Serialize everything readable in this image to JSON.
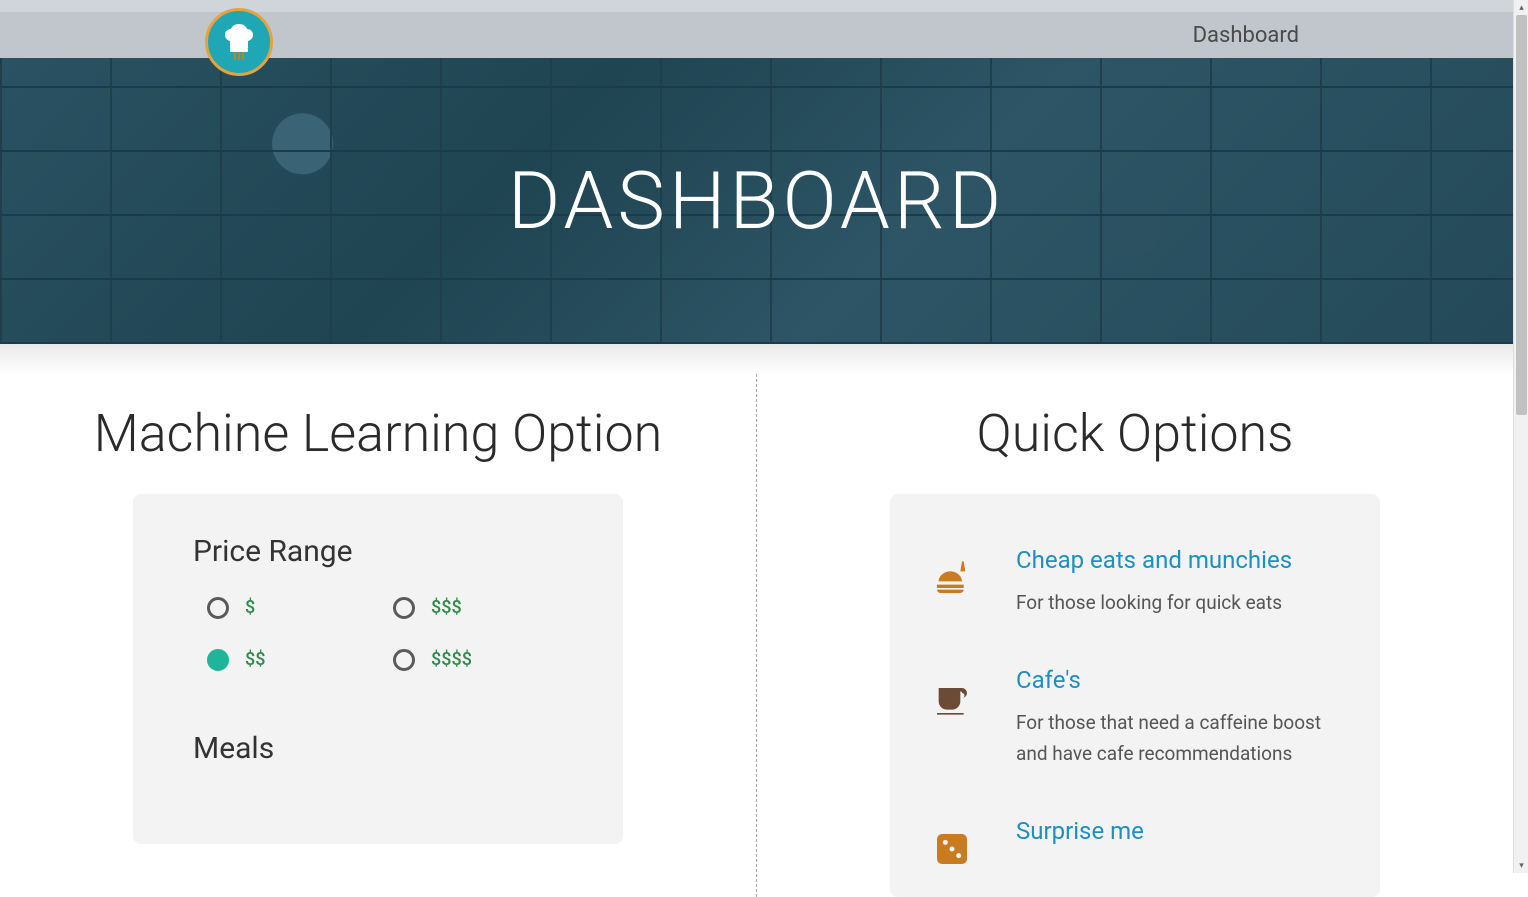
{
  "nav": {
    "link_dashboard": "Dashboard"
  },
  "hero": {
    "title": "DASHBOARD"
  },
  "ml": {
    "section_title": "Machine Learning Option",
    "price_range_heading": "Price Range",
    "next_heading": "Meals",
    "prices": [
      "$",
      "$$",
      "$$$",
      "$$$$"
    ],
    "selected_index": 1,
    "colors": {
      "radio_selected": "#1fb59b",
      "price_text": "#2f8b4a"
    }
  },
  "quick": {
    "section_title": "Quick Options",
    "items": [
      {
        "icon": "fastfood",
        "title": "Cheap eats and munchies",
        "desc": "For those looking for quick eats"
      },
      {
        "icon": "coffee",
        "title": "Cafe's",
        "desc": "For those that need a caffeine boost and have cafe recommendations"
      },
      {
        "icon": "dice",
        "title": "Surprise me",
        "desc": ""
      }
    ]
  }
}
